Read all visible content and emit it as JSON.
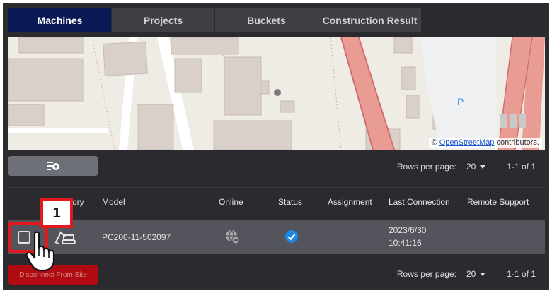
{
  "tabs": [
    {
      "label": "Machines",
      "active": true
    },
    {
      "label": "Projects",
      "active": false
    },
    {
      "label": "Buckets",
      "active": false
    },
    {
      "label": "Construction Result",
      "active": false
    }
  ],
  "map": {
    "attribution_prefix": "© ",
    "attribution_link": "OpenStreetMap",
    "attribution_suffix": " contributors.",
    "parking_label": "P"
  },
  "toolbar": {
    "add_icon": "playlist-add-icon",
    "rows_per_page_label": "Rows per page:",
    "rows_per_page_value": "20",
    "range": "1-1 of 1"
  },
  "table": {
    "columns": [
      "ory",
      "Model",
      "Online",
      "Status",
      "Assignment",
      "Last Connection",
      "Remote Support"
    ],
    "rows": [
      {
        "category_icon": "excavator-icon",
        "model": "PC200-11-502097",
        "online_icon": "offline-globe-icon",
        "status_icon": "check-circle-icon",
        "assignment": "",
        "last_connection_date": "2023/6/30",
        "last_connection_time": "10:41:16",
        "remote_support": ""
      }
    ]
  },
  "footer": {
    "disconnect_label": "Disconnect From Site",
    "rows_per_page_label": "Rows per page:",
    "rows_per_page_value": "20",
    "range": "1-1 of 1"
  },
  "annotation": {
    "step_number": "1"
  },
  "colors": {
    "active_tab": "#0b1a55",
    "status_check": "#1e88e5",
    "danger": "#b00a12",
    "highlight": "#e3171c"
  }
}
